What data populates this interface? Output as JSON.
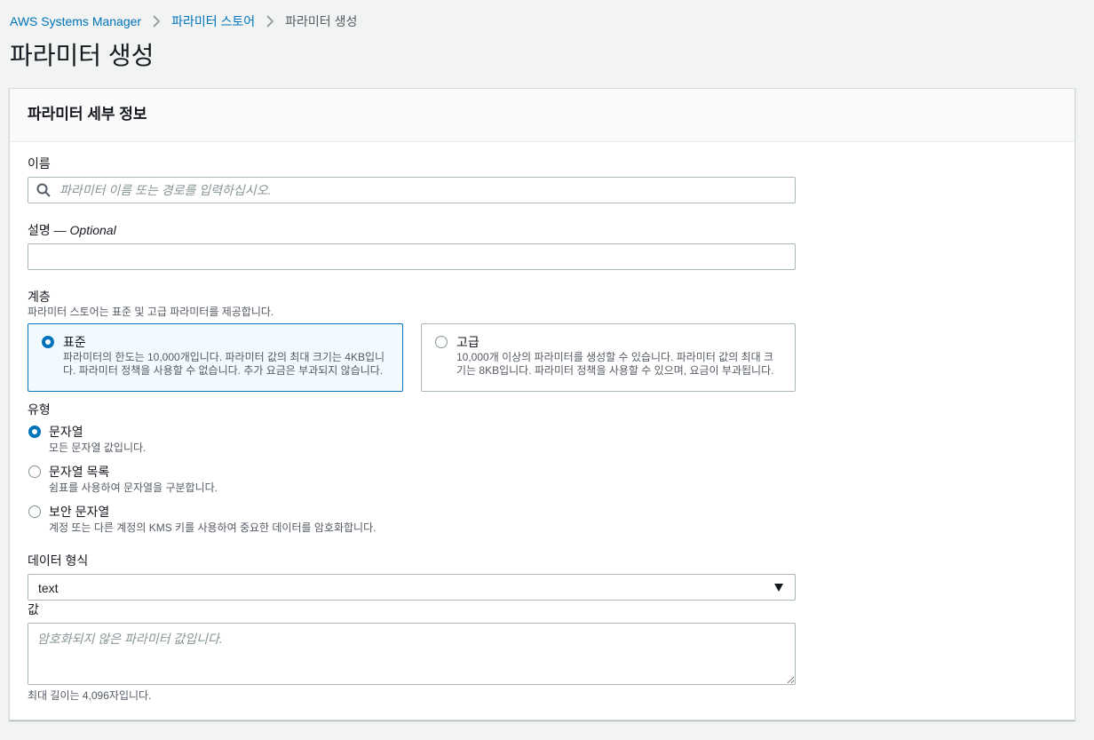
{
  "breadcrumb": {
    "items": [
      "AWS Systems Manager",
      "파라미터 스토어"
    ],
    "current": "파라미터 생성"
  },
  "page_title": "파라미터 생성",
  "panel": {
    "title": "파라미터 세부 정보",
    "name": {
      "label": "이름",
      "placeholder": "파라미터 이름 또는 경로를 입력하십시오.",
      "value": ""
    },
    "description": {
      "label": "설명",
      "optional_label": "— Optional",
      "value": ""
    },
    "tier": {
      "label": "계층",
      "hint": "파라미터 스토어는 표준 및 고급 파라미터를 제공합니다.",
      "options": [
        {
          "label": "표준",
          "desc": "파라미터의 한도는 10,000개입니다. 파라미터 값의 최대 크기는 4KB입니다. 파라미터 정책을 사용할 수 없습니다. 추가 요금은 부과되지 않습니다.",
          "selected": true
        },
        {
          "label": "고급",
          "desc": "10,000개 이상의 파라미터를 생성할 수 있습니다. 파라미터 값의 최대 크기는 8KB입니다. 파라미터 정책을 사용할 수 있으며, 요금이 부과됩니다.",
          "selected": false
        }
      ]
    },
    "type": {
      "label": "유형",
      "options": [
        {
          "label": "문자열",
          "desc": "모든 문자열 값입니다.",
          "selected": true
        },
        {
          "label": "문자열 목록",
          "desc": "쉼표를 사용하여 문자열을 구분합니다.",
          "selected": false
        },
        {
          "label": "보안 문자열",
          "desc": "계정 또는 다른 계정의 KMS 키를 사용하여 중요한 데이터를 암호화합니다.",
          "selected": false
        }
      ]
    },
    "data_type": {
      "label": "데이터 형식",
      "selected": "text"
    },
    "value": {
      "label": "값",
      "placeholder": "암호화되지 않은 파라미터 값입니다.",
      "hint": "최대 길이는 4,096자입니다."
    }
  },
  "colors": {
    "link": "#0073bb",
    "selected_tile_bg": "#f1faff",
    "page_bg": "#f2f3f3"
  },
  "icons": [
    "chevron-right-icon",
    "search-icon",
    "caret-down-icon"
  ]
}
